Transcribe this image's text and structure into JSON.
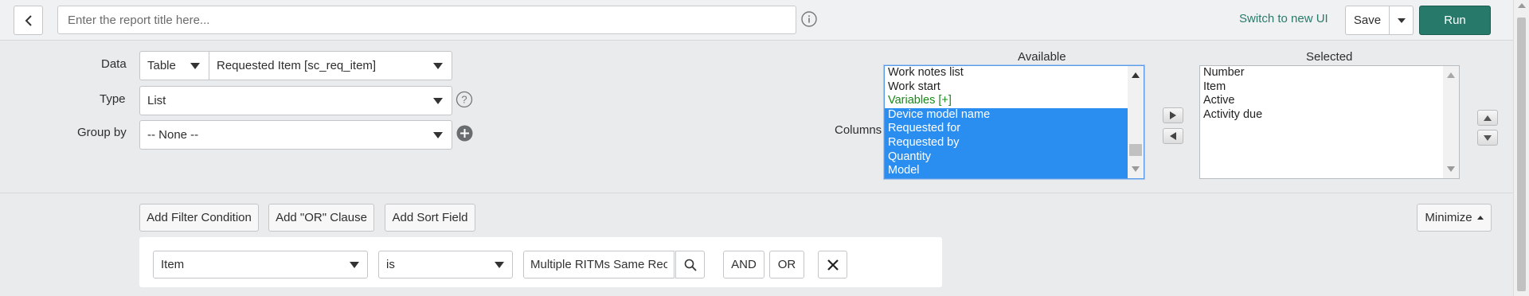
{
  "header": {
    "title_placeholder": "Enter the report title here...",
    "switch_link": "Switch to new UI",
    "save_label": "Save",
    "run_label": "Run"
  },
  "config": {
    "data_label": "Data",
    "data_source_type": "Table",
    "data_table": "Requested Item [sc_req_item]",
    "type_label": "Type",
    "type_value": "List",
    "group_by_label": "Group by",
    "group_by_value": "-- None --",
    "columns_label": "Columns",
    "available_heading": "Available",
    "selected_heading": "Selected",
    "available_options": [
      {
        "label": "Work notes list",
        "style": "normal"
      },
      {
        "label": "Work start",
        "style": "normal"
      },
      {
        "label": "Variables [+]",
        "style": "green"
      },
      {
        "label": "Device model name",
        "style": "selected"
      },
      {
        "label": "Requested for",
        "style": "selected"
      },
      {
        "label": "Requested by",
        "style": "selected"
      },
      {
        "label": "Quantity",
        "style": "selected"
      },
      {
        "label": "Model",
        "style": "selected"
      }
    ],
    "selected_options": [
      "Number",
      "Item",
      "Active",
      "Activity due"
    ]
  },
  "filter": {
    "add_condition": "Add Filter Condition",
    "add_or": "Add \"OR\" Clause",
    "add_sort": "Add Sort Field",
    "minimize": "Minimize",
    "field": "Item",
    "operator": "is",
    "value": "Multiple RITMs Same Rec",
    "and_label": "AND",
    "or_label": "OR"
  },
  "colors": {
    "run_button": "#27796a",
    "link": "#2a7a6b",
    "selection": "#2a8ef0",
    "variables_text": "#178a17"
  }
}
